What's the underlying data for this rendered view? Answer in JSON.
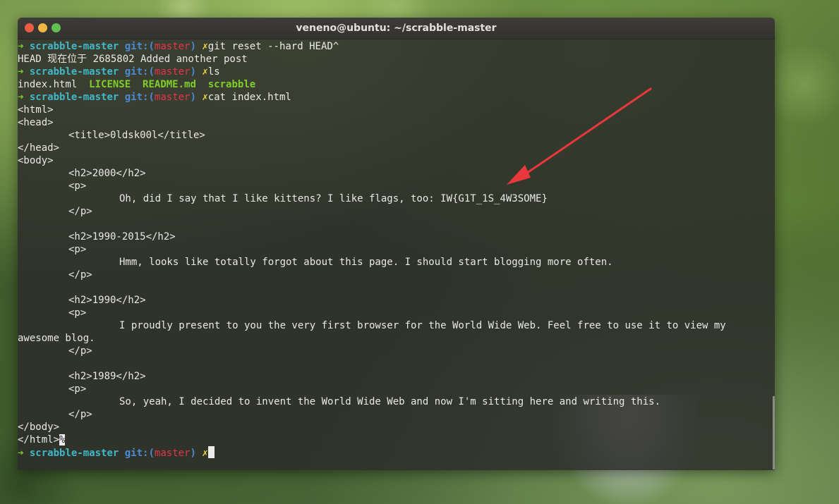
{
  "window": {
    "title": "veneno@ubuntu: ~/scrabble-master"
  },
  "prompt": {
    "arrow": "➜",
    "dir": "scrabble-master",
    "git": "git:(",
    "branch": "master",
    "git_close": ")",
    "dirty": "✗"
  },
  "commands": {
    "reset": "git reset --hard HEAD^",
    "ls": "ls",
    "cat": "cat index.html"
  },
  "output": {
    "reset_result": "HEAD 现在位于 2685802 Added another post",
    "ls_items": [
      "index.html",
      "LICENSE",
      "README.md",
      "scrabble"
    ],
    "html_lines": {
      "l1": "<html>",
      "l2": "<head>",
      "l3": "<title>0ldsk00l</title>",
      "l4": "</head>",
      "l5": "<body>",
      "l6": "<h2>2000</h2>",
      "l7": "<p>",
      "l8": "Oh, did I say that I like kittens? I like flags, too: IW{G1T_1S_4W3SOME}",
      "l9": "</p>",
      "l10": "<h2>1990-2015</h2>",
      "l11": "<p>",
      "l12": "Hmm, looks like totally forgot about this page. I should start blogging more often.",
      "l13": "</p>",
      "l14": "<h2>1990</h2>",
      "l15": "<p>",
      "l16": "I proudly present to you the very first browser for the World Wide Web. Feel free to use it to view my",
      "l17": "awesome blog.",
      "l18": "</p>",
      "l19": "<h2>1989</h2>",
      "l20": "<p>",
      "l21": "So, yeah, I decided to invent the World Wide Web and now I'm sitting here and writing this.",
      "l22": "</p>",
      "l23": "</body>",
      "l24": "</html>",
      "l24_mark": "%"
    }
  },
  "colors": {
    "prompt_arrow": "#7fce2d",
    "prompt_dir": "#3fb8c9",
    "prompt_git": "#4b8ad6",
    "prompt_branch": "#e3354a",
    "prompt_dirty": "#f0d93b",
    "annotation_arrow": "#e8383d"
  }
}
